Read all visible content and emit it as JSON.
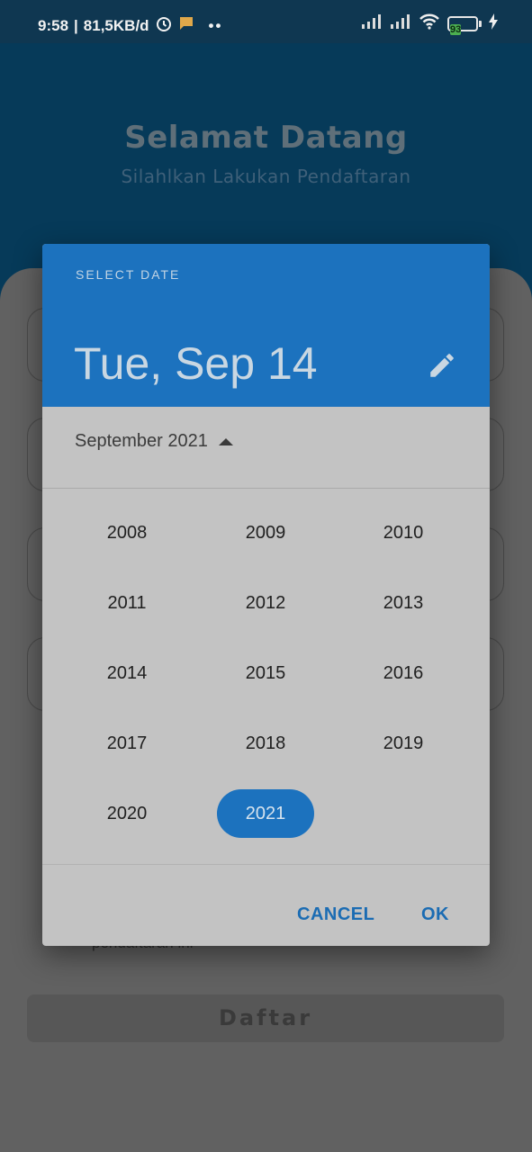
{
  "status_bar": {
    "time": "9:58",
    "speed": "81,5KB/d",
    "battery": "93",
    "icons": [
      "alarm-icon",
      "chat-icon",
      "more-icon",
      "signal-icon",
      "signal-icon",
      "wifi-icon",
      "battery-icon",
      "charging-icon"
    ]
  },
  "header": {
    "title": "Selamat Datang",
    "subtitle": "Silahlkan Lakukan Pendaftaran"
  },
  "form": {
    "terms_text": "pendaftaran ini",
    "submit_label": "Daftar"
  },
  "dialog": {
    "label": "SELECT DATE",
    "selected_date": "Tue, Sep 14",
    "month_label": "September 2021",
    "years": [
      "2008",
      "2009",
      "2010",
      "2011",
      "2012",
      "2013",
      "2014",
      "2015",
      "2016",
      "2017",
      "2018",
      "2019",
      "2020",
      "2021"
    ],
    "selected_year": "2021",
    "cancel_label": "CANCEL",
    "ok_label": "OK",
    "accent_color": "#1c72be"
  }
}
